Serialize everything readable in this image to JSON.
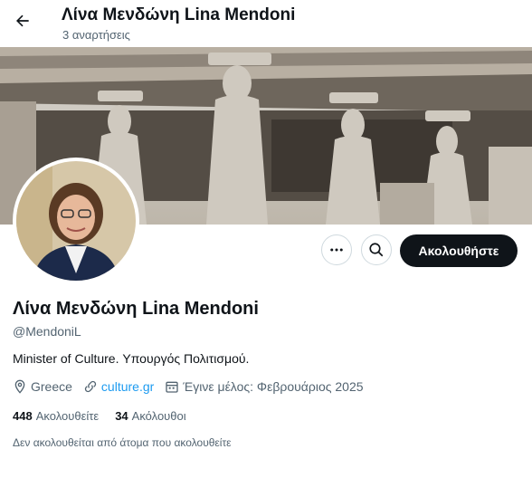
{
  "header": {
    "display_name": "Λίνα Μενδώνη Lina Mendoni",
    "post_count": "3 αναρτήσεις"
  },
  "profile": {
    "display_name": "Λίνα Μενδώνη Lina Mendoni",
    "handle": "@MendoniL",
    "bio": "Minister of Culture. Υπουργός Πολιτισμού.",
    "location": "Greece",
    "website": "culture.gr",
    "joined": "Έγινε μέλος: Φεβρουάριος 2025",
    "following_count": "448",
    "following_label": "Ακολουθείτε",
    "followers_count": "34",
    "followers_label": "Ακόλουθοι",
    "mutuals_note": "Δεν ακολουθείται από άτομα που ακολουθείτε"
  },
  "actions": {
    "follow_label": "Ακολουθήστε",
    "more_icon": "more-icon",
    "search_icon": "search-icon"
  },
  "colors": {
    "follow_bg": "#0f1419",
    "link": "#1d9bf0",
    "muted": "#536471"
  }
}
